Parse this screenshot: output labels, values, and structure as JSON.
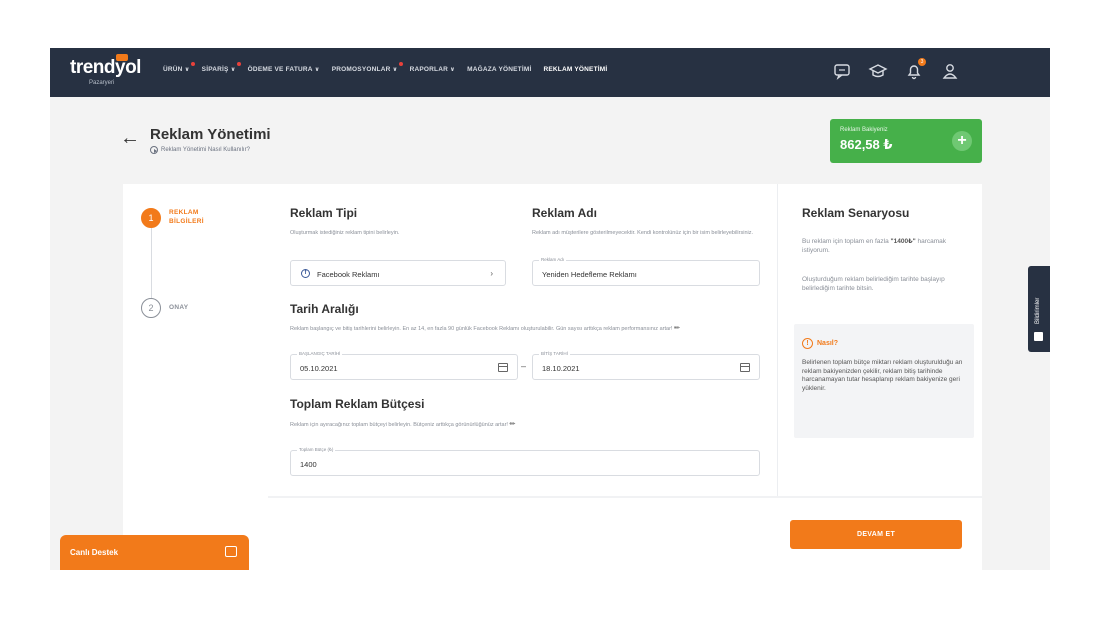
{
  "navbar": {
    "logo": "trendyol",
    "logo_sub": "Pazaryeri",
    "items": [
      {
        "label": "ÜRÜN",
        "chevron": true,
        "dot": true
      },
      {
        "label": "SİPARİŞ",
        "chevron": true,
        "dot": true
      },
      {
        "label": "ÖDEME VE FATURA",
        "chevron": true,
        "dot": false
      },
      {
        "label": "PROMOSYONLAR",
        "chevron": true,
        "dot": true
      },
      {
        "label": "RAPORLAR",
        "chevron": true,
        "dot": false
      },
      {
        "label": "MAĞAZA YÖNETİMİ",
        "chevron": false,
        "dot": false
      },
      {
        "label": "REKLAM YÖNETİMİ",
        "chevron": false,
        "dot": false,
        "active": true
      }
    ],
    "icons": [
      "message-icon",
      "graduation-cap-icon",
      "bell-icon",
      "user-icon"
    ],
    "notification_count": "3"
  },
  "header": {
    "title": "Reklam Yönetimi",
    "help_link": "Reklam Yönetimi Nasıl Kullanılır?"
  },
  "balance": {
    "label": "Reklam Bakiyeniz",
    "value": "862,58 ₺"
  },
  "stepper": {
    "steps": [
      {
        "number": "1",
        "label": "REKLAM\nBİLGİLERİ",
        "active": true
      },
      {
        "number": "2",
        "label": "ONAY",
        "active": false
      }
    ]
  },
  "form": {
    "ad_type": {
      "title": "Reklam Tipi",
      "desc": "Oluşturmak istediğiniz reklam tipini belirleyin.",
      "value": "Facebook Reklamı"
    },
    "ad_name": {
      "title": "Reklam Adı",
      "desc": "Reklam adı müşterilere gösterilmeyecektir. Kendi kontrolünüz için bir isim belirleyebilirsiniz.",
      "label": "Reklam Adı",
      "value": "Yeniden Hedefleme Reklamı"
    },
    "date_range": {
      "title": "Tarih Aralığı",
      "desc": "Reklam başlangıç ve bitiş tarihlerini belirleyin. En az 14, en fazla 90 günlük Facebook Reklamı oluşturulabilir. Gün sayısı arttıkça reklam performansınız artar!",
      "start_label": "BAŞLANGIÇ TARİHİ",
      "start_value": "05.10.2021",
      "end_label": "BİTİŞ TARİHİ",
      "end_value": "18.10.2021"
    },
    "budget": {
      "title": "Toplam Reklam Bütçesi",
      "desc": "Reklam için ayıracağınız toplam bütçeyi belirleyin. Bütçeniz arttıkça görünürlüğünüz artar!",
      "label": "Toplam Bütçe (₺)",
      "value": "1400"
    }
  },
  "scenario": {
    "title": "Reklam Senaryosu",
    "text1_pre": "Bu reklam için toplam en fazla",
    "text1_amount": "\"1400₺\"",
    "text1_post": "harcamak istiyorum.",
    "text2": "Oluşturduğum reklam belirlediğim tarihte başlayıp belirlediğim tarihte bitsin.",
    "how_title": "Nasıl?",
    "how_text": "Belirlenen toplam bütçe miktarı reklam oluşturulduğu an reklam bakiyenizden çekilir, reklam bitiş tarihinde harcanamayan tutar hesaplanıp reklam bakiyenize geri yüklenir."
  },
  "actions": {
    "continue": "DEVAM ET"
  },
  "live_support": {
    "label": "Canlı Destek"
  },
  "side_tab": {
    "label": "Bildirimler"
  }
}
